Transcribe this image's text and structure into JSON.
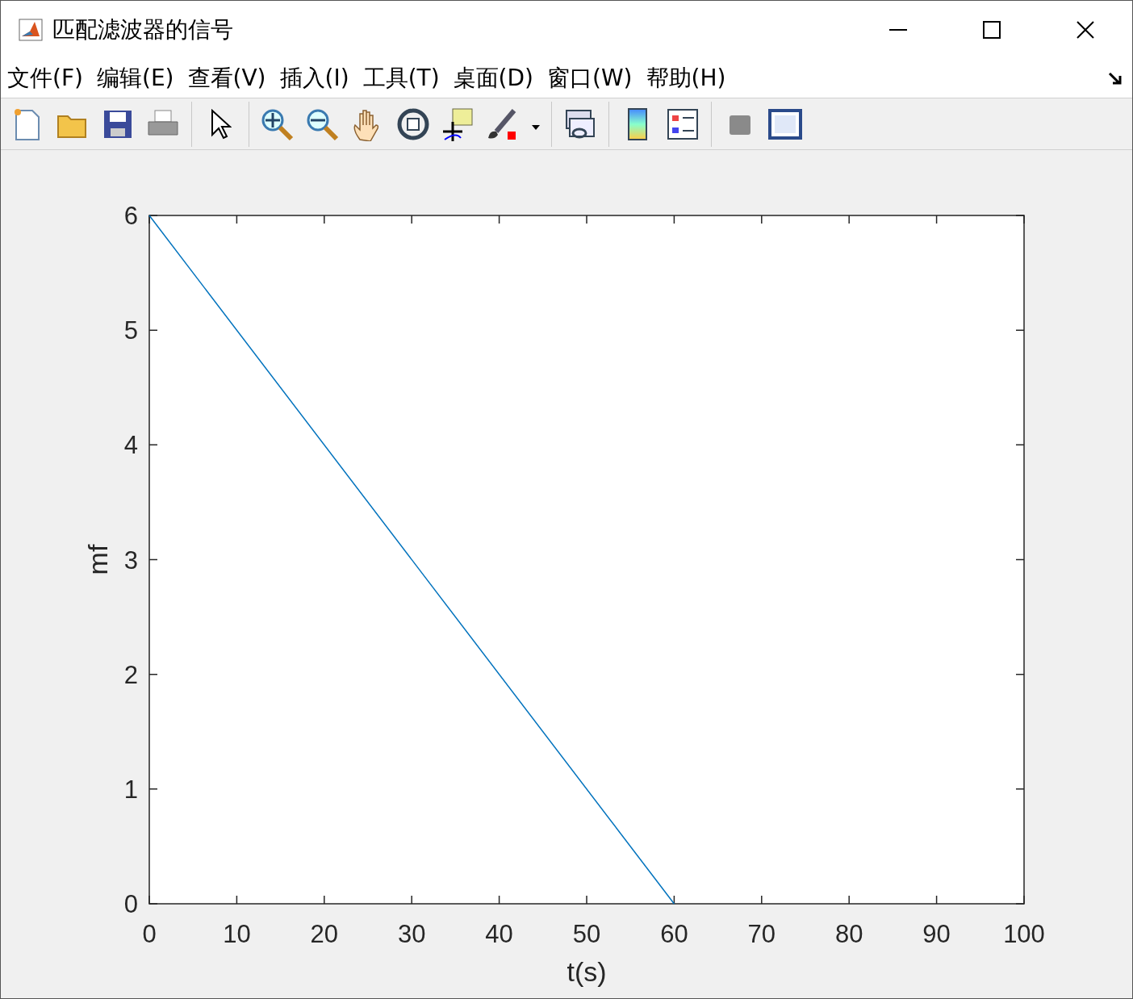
{
  "window": {
    "title": "匹配滤波器的信号"
  },
  "menu": [
    {
      "label": "文件(F)"
    },
    {
      "label": "编辑(E)"
    },
    {
      "label": "查看(V)"
    },
    {
      "label": "插入(I)"
    },
    {
      "label": "工具(T)"
    },
    {
      "label": "桌面(D)"
    },
    {
      "label": "窗口(W)"
    },
    {
      "label": "帮助(H)"
    }
  ],
  "toolbar": [
    {
      "kind": "new"
    },
    {
      "kind": "open"
    },
    {
      "kind": "save"
    },
    {
      "kind": "print"
    },
    {
      "kind": "sep"
    },
    {
      "kind": "pointer"
    },
    {
      "kind": "sep"
    },
    {
      "kind": "zoomin"
    },
    {
      "kind": "zoomout"
    },
    {
      "kind": "pan"
    },
    {
      "kind": "rotate"
    },
    {
      "kind": "cursor"
    },
    {
      "kind": "brush"
    },
    {
      "kind": "sep"
    },
    {
      "kind": "link"
    },
    {
      "kind": "sep"
    },
    {
      "kind": "colorbar"
    },
    {
      "kind": "legend"
    },
    {
      "kind": "sep"
    },
    {
      "kind": "hide"
    },
    {
      "kind": "show"
    }
  ],
  "chart_data": {
    "type": "line",
    "xlabel": "t(s)",
    "ylabel": "mf",
    "xlim": [
      0,
      100
    ],
    "ylim": [
      0,
      6
    ],
    "xticks": [
      0,
      10,
      20,
      30,
      40,
      50,
      60,
      70,
      80,
      90,
      100
    ],
    "yticks": [
      0,
      1,
      2,
      3,
      4,
      5,
      6
    ],
    "series": [
      {
        "color": "#0072bd",
        "values": [
          6,
          0
        ]
      }
    ],
    "x": [
      0,
      60
    ]
  }
}
